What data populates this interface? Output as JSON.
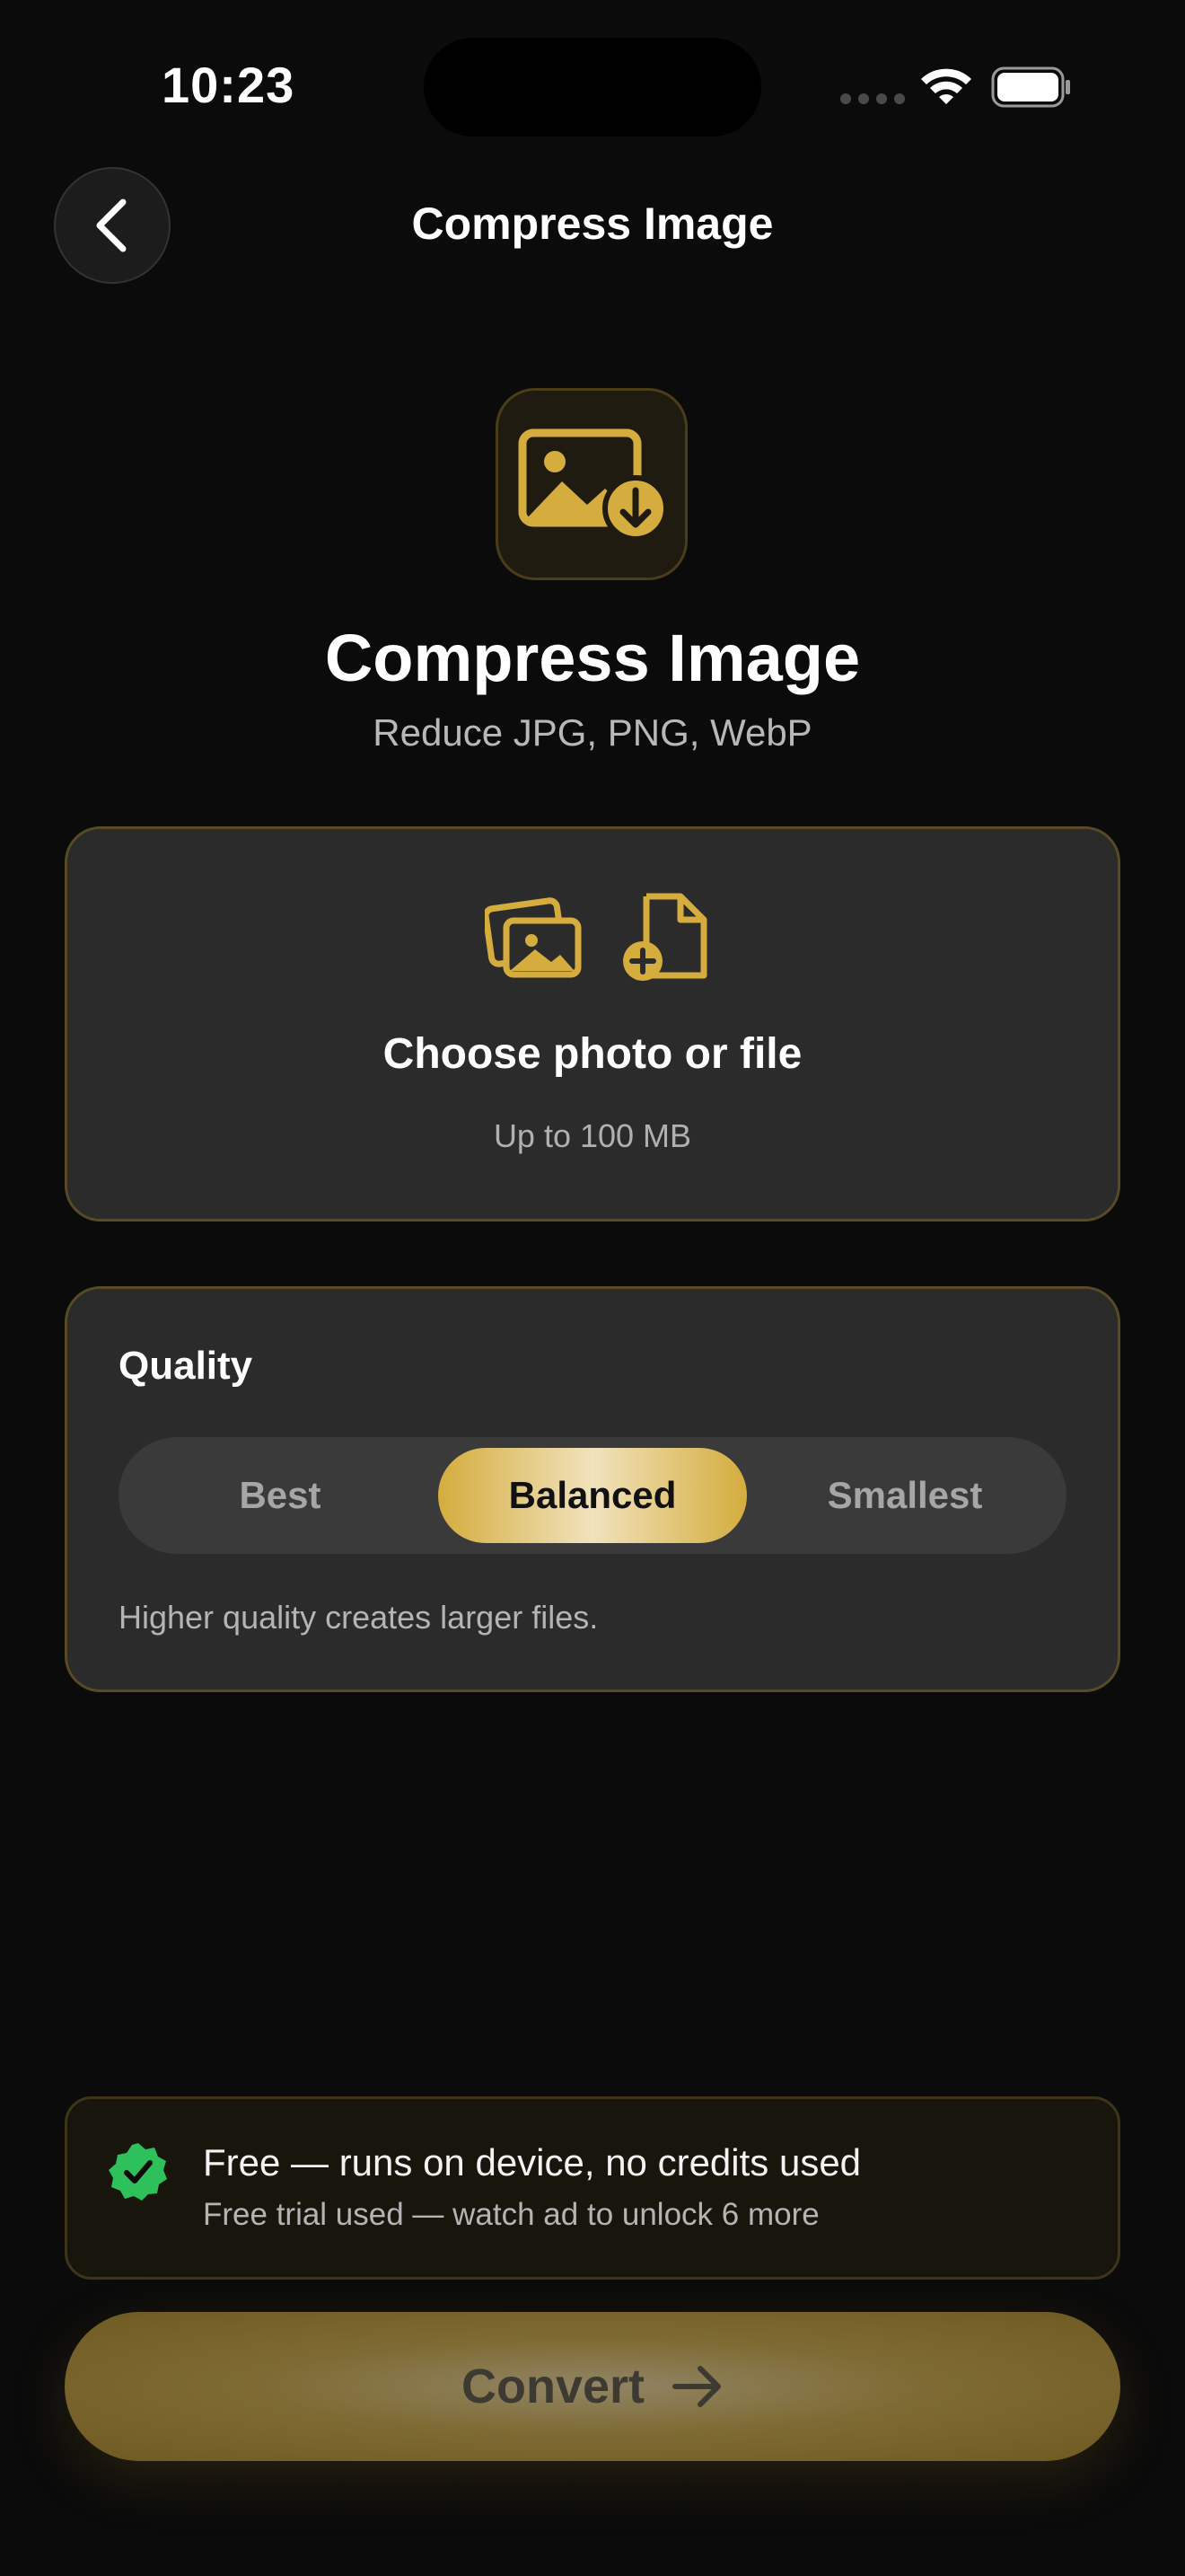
{
  "status_bar": {
    "time": "10:23"
  },
  "nav": {
    "back_icon": "chevron-left-icon",
    "title": "Compress Image"
  },
  "hero": {
    "icon": "image-download-icon",
    "title": "Compress Image",
    "subtitle": "Reduce JPG, PNG, WebP"
  },
  "upload": {
    "title": "Choose photo or file",
    "subtitle": "Up to 100 MB",
    "icons": [
      "photos-icon",
      "file-add-icon"
    ]
  },
  "quality": {
    "label": "Quality",
    "options": [
      "Best",
      "Balanced",
      "Smallest"
    ],
    "selected": "Balanced",
    "hint": "Higher quality creates larger files."
  },
  "free_banner": {
    "icon": "verified-check-icon",
    "title": "Free — runs on device, no credits used",
    "subtitle": "Free trial used — watch ad to unlock 6 more"
  },
  "convert": {
    "label": "Convert",
    "icon": "arrow-right-icon"
  },
  "colors": {
    "background": "#0b0b0b",
    "accent_gold": "#d4ad3e",
    "card": "#2b2b2b",
    "success_green": "#2ec05a"
  }
}
